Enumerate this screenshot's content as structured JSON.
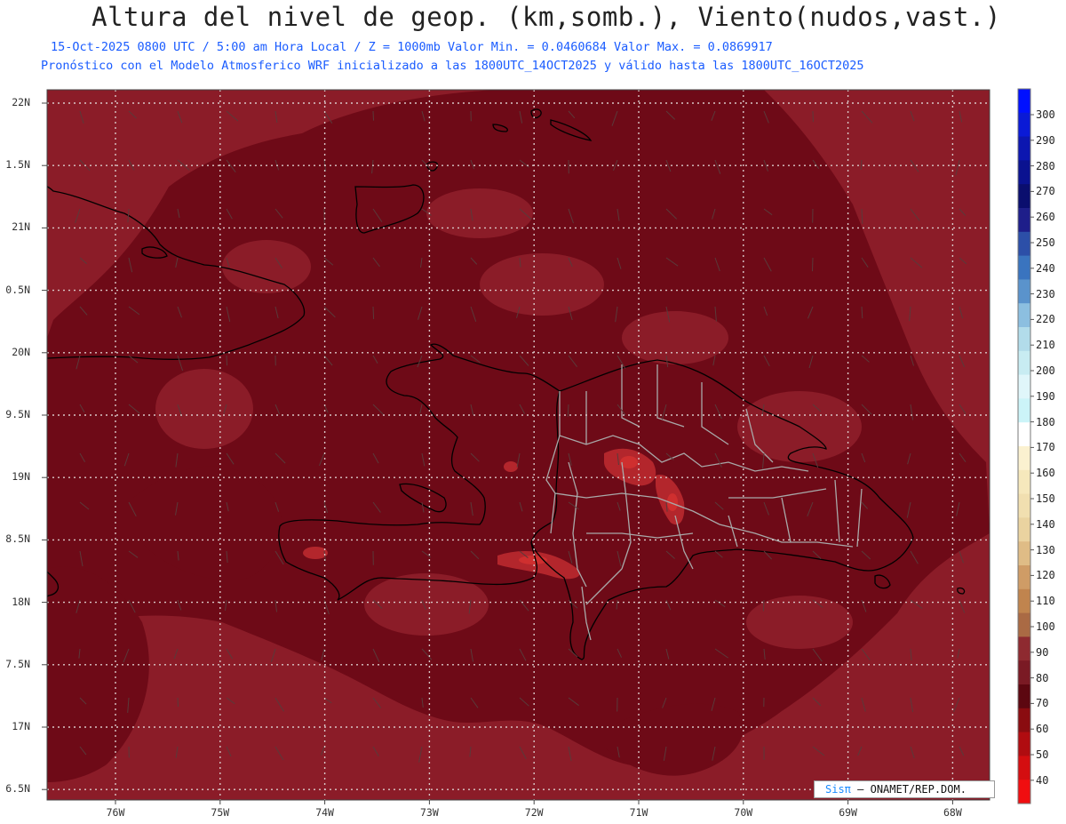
{
  "header": {
    "title": "Altura del nivel de geop. (km,somb.), Viento(nudos,vast.)",
    "subtitle1": "15-Oct-2025  0800 UTC / 5:00 am Hora Local / Z = 1000mb Valor Min. = 0.0460684  Valor Max. = 0.0869917",
    "subtitle2": "Pronóstico con el Modelo Atmosferico WRF inicializado a las 1800UTC_14OCT2025 y válido hasta las  1800UTC_16OCT2025"
  },
  "map": {
    "lat_labels": [
      "22N",
      "1.5N",
      "21N",
      "0.5N",
      "20N",
      "9.5N",
      "19N",
      "8.5N",
      "18N",
      "7.5N",
      "17N",
      "6.5N"
    ],
    "lon_labels": [
      "76W",
      "75W",
      "74W",
      "73W",
      "72W",
      "71W",
      "70W",
      "69W",
      "68W"
    ],
    "background_color": "#8b1c28",
    "dark_fill_color": "#6e0a17",
    "high_fill_color": "#b3262c",
    "peak_fill_color": "#cf2f2f",
    "coast_color": "#000000",
    "province_color": "#a9a9a9",
    "grid_color": "#d9c7c7"
  },
  "colorbar": {
    "labels": [
      "300",
      "290",
      "280",
      "270",
      "260",
      "250",
      "240",
      "230",
      "220",
      "210",
      "200",
      "190",
      "180",
      "170",
      "160",
      "150",
      "140",
      "130",
      "120",
      "110",
      "100",
      "90",
      "80",
      "70",
      "60",
      "50",
      "40"
    ],
    "colors": [
      "#0010ff",
      "#0a1ad6",
      "#0c16b0",
      "#0a1290",
      "#0a0e6e",
      "#1e1e8a",
      "#2c4fa8",
      "#3a74bf",
      "#5a93cc",
      "#8cbfe0",
      "#b2dcea",
      "#c8ecf2",
      "#e0f6fa",
      "#ccf4f8",
      "#ffffff",
      "#fbf1d0",
      "#f6e8bc",
      "#f1dfb0",
      "#ead3a0",
      "#dfbc86",
      "#cf9c66",
      "#c0844e",
      "#aa6a44",
      "#8e2a30",
      "#7a1a24",
      "#5c0710",
      "#8a0c10",
      "#b00c10",
      "#d40e10",
      "#f00e10"
    ]
  },
  "credit": {
    "sis": "Sisπ",
    "text": "– ONAMET/REP.DOM."
  }
}
